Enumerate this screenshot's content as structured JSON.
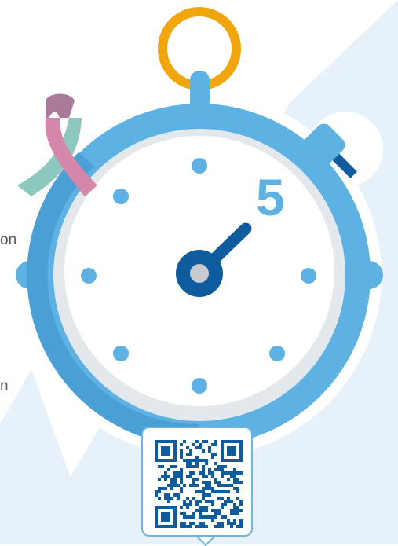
{
  "edge_text": {
    "line1": "on",
    "line2": "n"
  },
  "stopwatch": {
    "number": "5"
  },
  "colors": {
    "background_panel": "#e6f1f9",
    "stopwatch_blue": "#5db2e3",
    "stopwatch_dark": "#4a9fd4",
    "dial_ring": "#e3e8ec",
    "hand": "#0e5c9e",
    "crown_ring": "#f2a60e",
    "ribbon_pink": "#d487a8",
    "ribbon_teal": "#8cc8bd",
    "ribbon_mauve": "#a97b98",
    "number": "#5db2e3",
    "qr_dots": "#0e5c9e"
  },
  "icons": {
    "ribbon": "awareness-ribbon-icon",
    "stopwatch": "stopwatch-icon",
    "qr": "qr-code-icon"
  }
}
